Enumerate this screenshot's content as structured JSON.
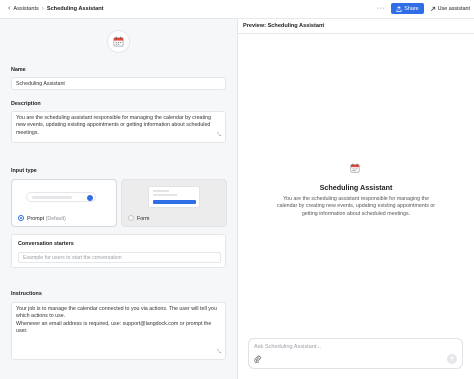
{
  "breadcrumb": {
    "parent": "Assistants",
    "current": "Scheduling Assistant"
  },
  "toolbar": {
    "more_label": "···",
    "share_label": "Share",
    "use_label": "Use assistant"
  },
  "editor": {
    "name_label": "Name",
    "name_value": "Scheduling Assistant",
    "description_label": "Description",
    "description_value": "You are the scheduling assistant responsible for managing the calendar by creating new events, updating existing appointments or getting information about scheduled meetings.",
    "input_type_label": "Input type",
    "input_types": [
      {
        "label": "Prompt",
        "note": "(Default)",
        "selected": true
      },
      {
        "label": "Form",
        "note": "",
        "selected": false
      }
    ],
    "starters_label": "Conversation starters",
    "starters_placeholder": "Example for users to start the conversation",
    "instructions_label": "Instructions",
    "instructions_lines": [
      "Your job is to manage the calendar connected to you via actions. The user will tell you which actions to use.",
      "Whenever an email address is required, use: support@langdock.com or prompt the user."
    ]
  },
  "preview": {
    "title": "Preview: Scheduling Assistant",
    "name": "Scheduling Assistant",
    "description": "You are the scheduling assistant responsible for managing the calendar by creating new events, updating existing appointments or getting information about scheduled meetings.",
    "chat_placeholder": "Ask Scheduling Assistant..."
  },
  "colors": {
    "accent": "#2f6ee6",
    "panel_bg": "#f6f7f8",
    "border": "#e4e6e9"
  },
  "icons": [
    "back-arrow-icon",
    "more-icon",
    "share-icon",
    "use-arrow-icon",
    "calendar-icon",
    "resize-icon",
    "paperclip-icon",
    "send-arrow-icon"
  ]
}
